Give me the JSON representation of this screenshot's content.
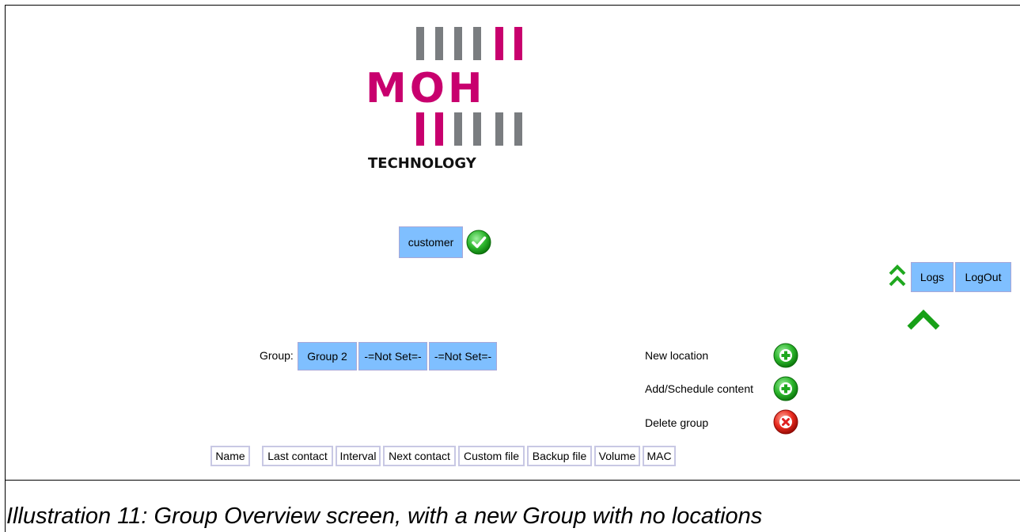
{
  "logo": {
    "name": "MOH",
    "tagline": "TECHNOLOGY",
    "brand_color": "#c8006e",
    "secondary_color": "#7a7d80"
  },
  "user": {
    "role_button": "customer",
    "confirm_icon": "check-circle-icon"
  },
  "header_actions": {
    "collapse_icon": "double-chevron-up-icon",
    "logs": "Logs",
    "logout": "LogOut",
    "up_icon": "chevron-up-icon"
  },
  "group": {
    "label": "Group:",
    "selectors": [
      "Group 2",
      "-=Not Set=-",
      "-=Not Set=-"
    ]
  },
  "actions": [
    {
      "label": "New location",
      "icon": "plus-circle-icon",
      "color": "#1fa81f"
    },
    {
      "label": "Add/Schedule content",
      "icon": "plus-circle-icon",
      "color": "#1fa81f"
    },
    {
      "label": "Delete group",
      "icon": "x-circle-icon",
      "color": "#e02020"
    }
  ],
  "table": {
    "columns": [
      "Name",
      "Last contact",
      "Interval",
      "Next contact",
      "Custom file",
      "Backup file",
      "Volume",
      "MAC"
    ]
  },
  "button_color": "#7fbfff",
  "caption": "Illustration 11: Group Overview screen, with a new Group with no locations"
}
